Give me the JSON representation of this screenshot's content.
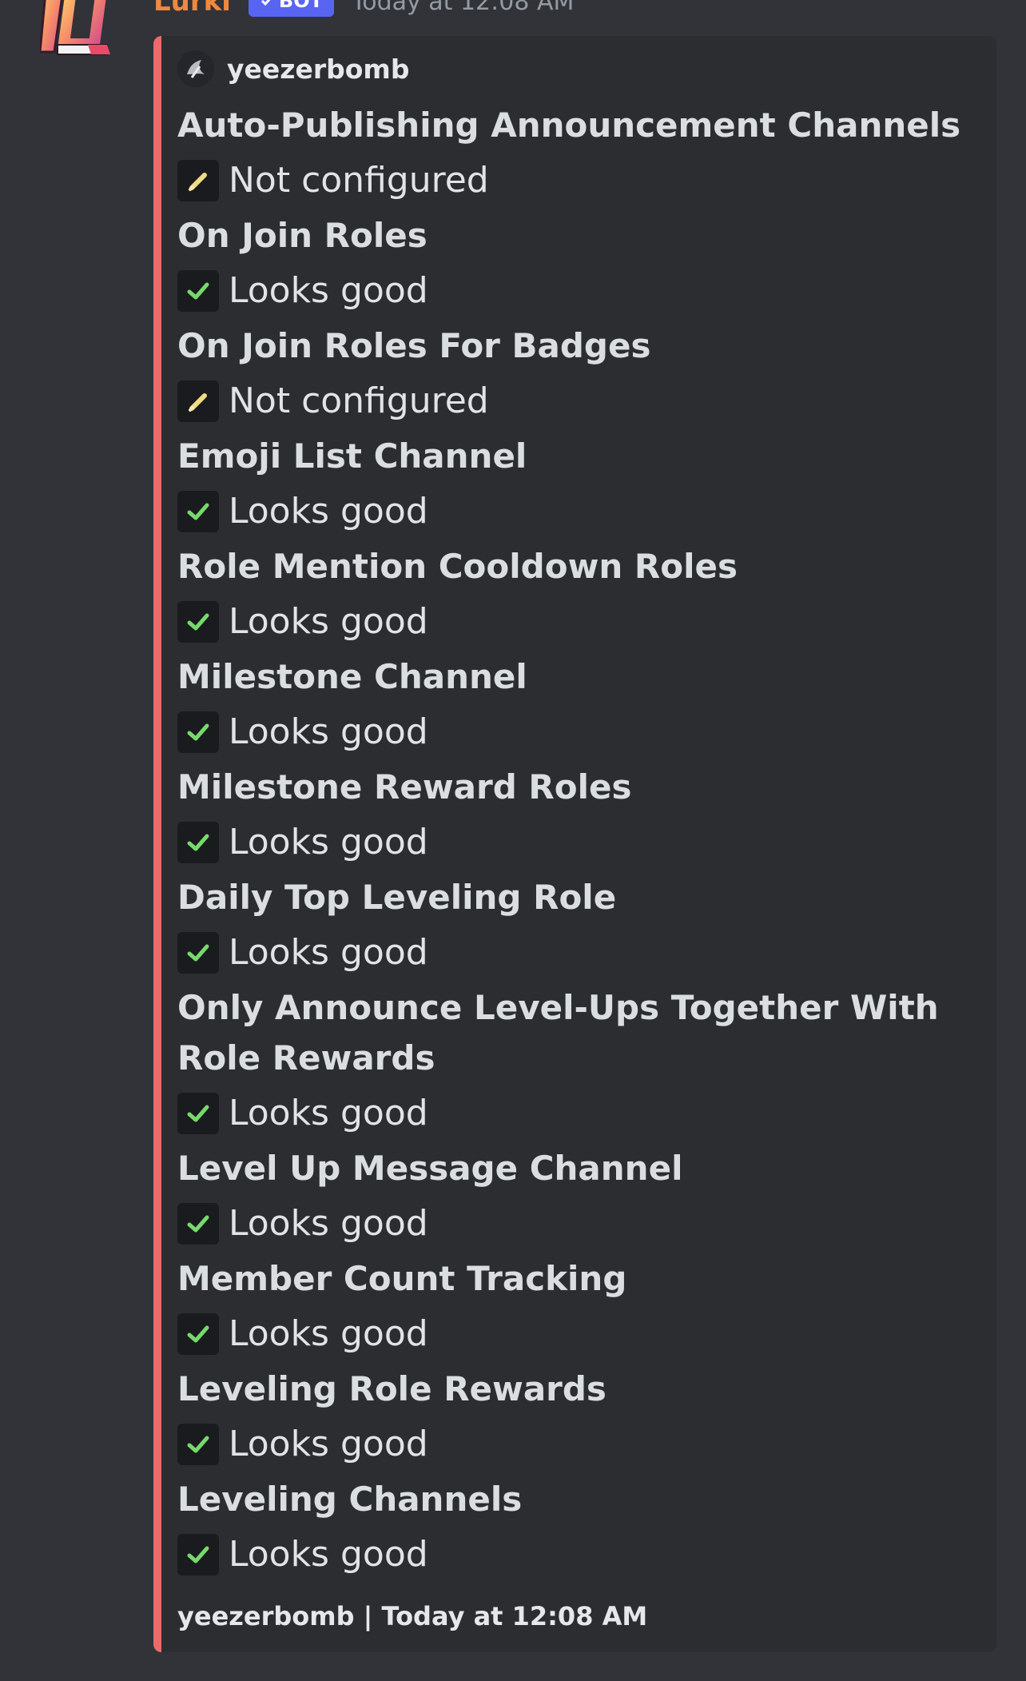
{
  "message": {
    "author": "Lurki",
    "bot_tag": "BOT",
    "timestamp": "Today at 12:08 AM"
  },
  "embed": {
    "accent_color": "#ed6a6a",
    "author_name": "yeezerbomb",
    "fields": [
      {
        "name": "Auto-Publishing Announcement Channels",
        "status": "pending",
        "value": "Not configured"
      },
      {
        "name": "On Join Roles",
        "status": "ok",
        "value": "Looks good"
      },
      {
        "name": "On Join Roles For Badges",
        "status": "pending",
        "value": "Not configured"
      },
      {
        "name": "Emoji List Channel",
        "status": "ok",
        "value": "Looks good"
      },
      {
        "name": "Role Mention Cooldown Roles",
        "status": "ok",
        "value": "Looks good"
      },
      {
        "name": "Milestone Channel",
        "status": "ok",
        "value": "Looks good"
      },
      {
        "name": "Milestone Reward Roles",
        "status": "ok",
        "value": "Looks good"
      },
      {
        "name": "Daily Top Leveling Role",
        "status": "ok",
        "value": "Looks good"
      },
      {
        "name": "Only Announce Level-Ups Together With Role Rewards",
        "status": "ok",
        "value": "Looks good"
      },
      {
        "name": "Level Up Message Channel",
        "status": "ok",
        "value": "Looks good"
      },
      {
        "name": "Member Count Tracking",
        "status": "ok",
        "value": "Looks good"
      },
      {
        "name": "Leveling Role Rewards",
        "status": "ok",
        "value": "Looks good"
      },
      {
        "name": "Leveling Channels",
        "status": "ok",
        "value": "Looks good"
      }
    ],
    "footer": "yeezerbomb | Today at 12:08 AM"
  },
  "icons": {
    "ok": "checkmark-icon",
    "pending": "pencil-icon"
  },
  "colors": {
    "ok": "#77d96c",
    "pending": "#f0dc82",
    "author": "#f0893e",
    "bot_tag": "#5865f2"
  }
}
